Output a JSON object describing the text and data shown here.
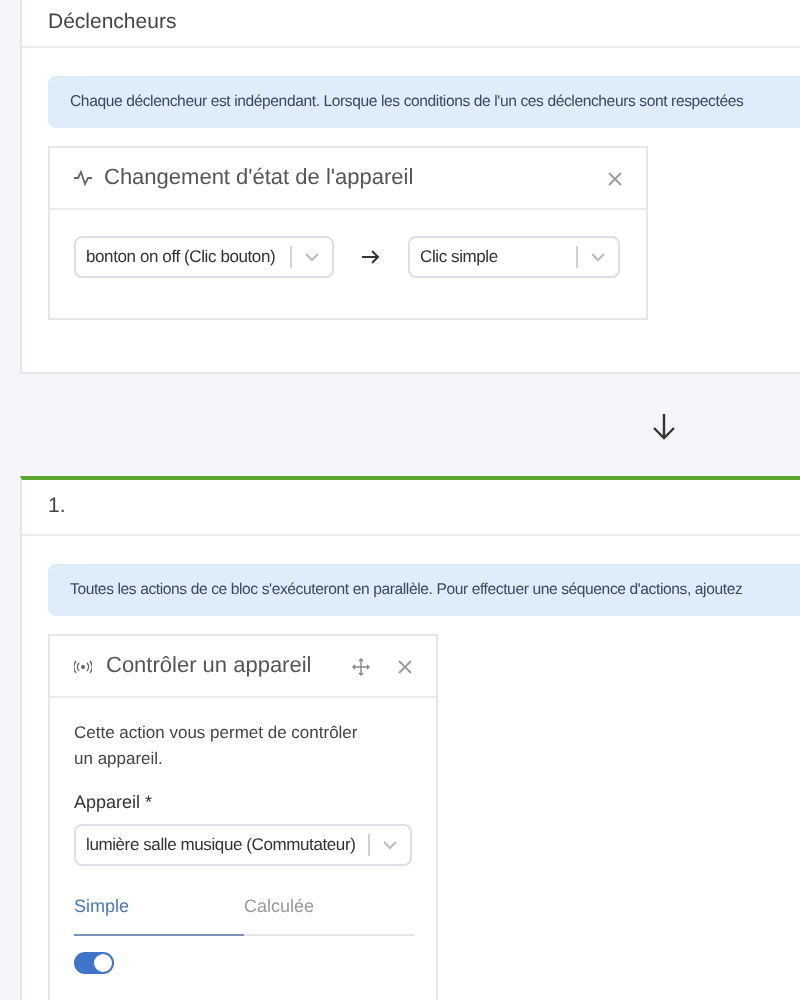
{
  "triggers": {
    "title": "Déclencheurs",
    "info": "Chaque déclencheur est indépendant. Lorsque les conditions de l'un ces déclencheurs sont respectées",
    "card": {
      "title": "Changement d'état de l'appareil",
      "source": {
        "value": "bonton on off (Clic bouton)"
      },
      "target": {
        "value": "Clic simple"
      }
    }
  },
  "block": {
    "title": "1.",
    "info": "Toutes les actions de ce bloc s'exécuteront en parallèle. Pour effectuer une séquence d'actions, ajoutez",
    "card": {
      "title": "Contrôler un appareil",
      "description": "Cette action vous permet de contrôler un appareil.",
      "device_label": "Appareil *",
      "device": {
        "value": "lumière salle musique (Commutateur)"
      },
      "tabs": [
        {
          "label": "Simple",
          "selected": true
        },
        {
          "label": "Calculée",
          "selected": false
        }
      ],
      "toggle": {
        "on": true
      }
    }
  }
}
